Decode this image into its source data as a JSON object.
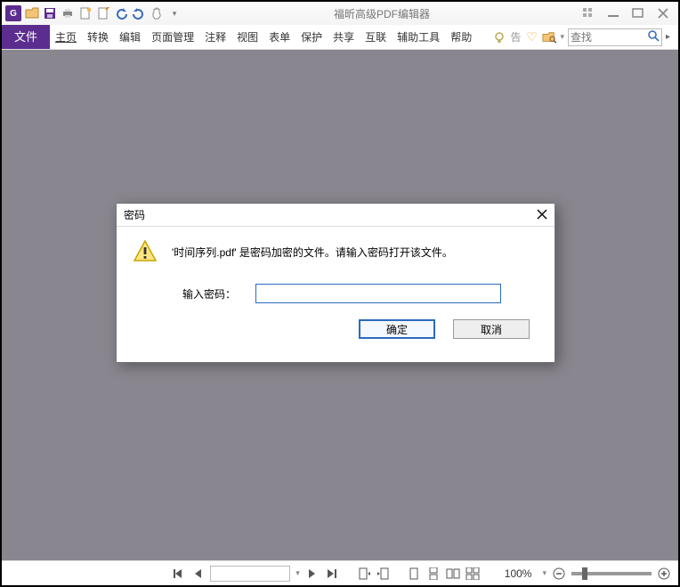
{
  "app": {
    "title": "福昕高级PDF编辑器",
    "logo_letter": "G"
  },
  "menubar": {
    "file_label": "文件",
    "items": [
      "主页",
      "转换",
      "编辑",
      "页面管理",
      "注释",
      "视图",
      "表单",
      "保护",
      "共享",
      "互联",
      "辅助工具",
      "帮助"
    ],
    "tell_me": "告",
    "search_placeholder": "查找"
  },
  "statusbar": {
    "zoom_text": "100%"
  },
  "dialog": {
    "title": "密码",
    "message": "'时间序列.pdf' 是密码加密的文件。请输入密码打开该文件。",
    "input_label": "输入密码：",
    "ok_label": "确定",
    "cancel_label": "取消"
  }
}
